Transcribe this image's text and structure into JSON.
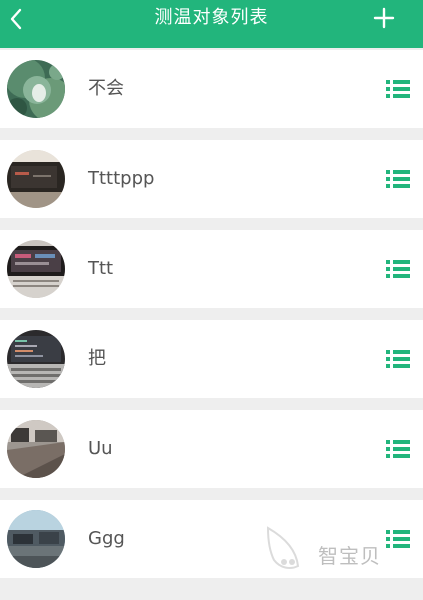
{
  "header": {
    "title": "测温对象列表",
    "back_icon": "chevron-left-icon",
    "add_icon": "plus-icon",
    "background": "#22b57c"
  },
  "list": {
    "items": [
      {
        "name": "不会",
        "avatar": "lotus-leaf-photo"
      },
      {
        "name": "Ttttppp",
        "avatar": "monitor-photo"
      },
      {
        "name": "Ttt",
        "avatar": "screen-photo"
      },
      {
        "name": "把",
        "avatar": "laptop-keyboard-photo"
      },
      {
        "name": "Uu",
        "avatar": "desk-photo"
      },
      {
        "name": "Ggg",
        "avatar": "office-photo"
      }
    ],
    "action_icon": "list-icon",
    "accent": "#22b57c"
  },
  "watermark": {
    "text": "智宝贝"
  }
}
